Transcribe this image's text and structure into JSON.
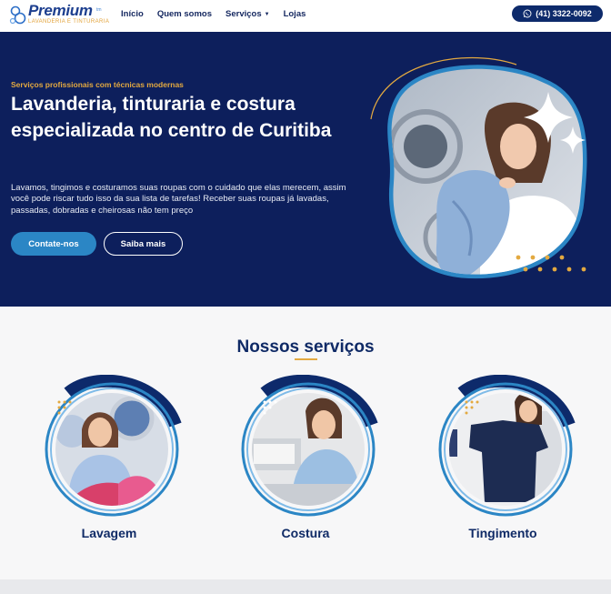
{
  "brand": {
    "name": "Premium",
    "tm": "tm",
    "tagline": "LAVANDERIA E TINTURARIA",
    "colors": {
      "navy": "#0d1f5c",
      "accent": "#e3a940",
      "blue": "#2b86c5"
    }
  },
  "nav": {
    "items": [
      {
        "label": "Início"
      },
      {
        "label": "Quem somos"
      },
      {
        "label": "Serviços",
        "has_dropdown": true
      },
      {
        "label": "Lojas"
      }
    ],
    "dropdown_icon": "caret-down-icon"
  },
  "phone": {
    "label": "(41) 3322-0092",
    "icon": "whatsapp-icon"
  },
  "hero": {
    "kicker": "Serviços profissionais com técnicas modernas",
    "title": "Lavanderia, tinturaria e costura especializada no centro de Curitiba",
    "text": "Lavamos, tingimos e costuramos suas roupas com o cuidado que elas merecem, assim você pode riscar tudo isso da sua lista de tarefas! Receber suas roupas já lavadas, passadas, dobradas e cheirosas não tem preço",
    "buttons": {
      "contact": "Contate-nos",
      "more": "Saiba mais"
    }
  },
  "services": {
    "title": "Nossos serviços",
    "items": [
      {
        "name": "Lavagem"
      },
      {
        "name": "Costura"
      },
      {
        "name": "Tingimento"
      }
    ]
  }
}
